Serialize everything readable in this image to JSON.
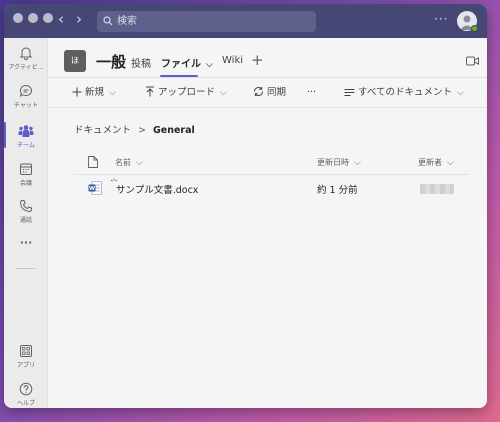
{
  "titlebar": {
    "search_placeholder": "検索",
    "more_label": "···"
  },
  "rail": {
    "items": [
      {
        "label": "アクティビ...",
        "icon": "bell-icon"
      },
      {
        "label": "チャット",
        "icon": "chat-icon"
      },
      {
        "label": "チーム",
        "icon": "teams-icon",
        "active": true
      },
      {
        "label": "会議",
        "icon": "calendar-icon"
      },
      {
        "label": "通話",
        "icon": "phone-icon"
      },
      {
        "label": "···",
        "icon": "more-icon"
      },
      {
        "label": "アプリ",
        "icon": "apps-icon"
      },
      {
        "label": "ヘルプ",
        "icon": "help-icon"
      }
    ]
  },
  "channel": {
    "avatar_text": "ほ",
    "name": "一般",
    "tabs": [
      {
        "label": "投稿"
      },
      {
        "label": "ファイル",
        "active": true
      },
      {
        "label": "Wiki"
      }
    ],
    "add_tab": "+"
  },
  "toolbar": {
    "new_label": "新規",
    "upload_label": "アップロード",
    "sync_label": "同期",
    "more_label": "···",
    "view_label": "すべてのドキュメント"
  },
  "breadcrumb": {
    "root": "ドキュメント",
    "current": "General"
  },
  "list": {
    "headers": {
      "name": "名前",
      "modified": "更新日時",
      "modified_by": "更新者"
    },
    "rows": [
      {
        "name": "サンプル文書.docx",
        "modified": "約 1 分前",
        "file_icon": "word-file-icon"
      }
    ]
  },
  "colors": {
    "titlebar": "#464775",
    "accent": "#5b5fc7",
    "background": "#f5f5f5"
  }
}
